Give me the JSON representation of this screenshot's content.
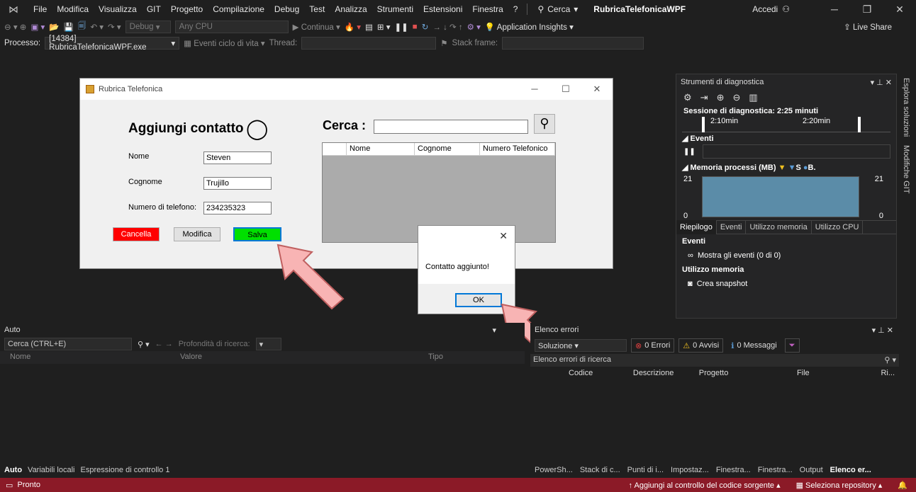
{
  "menubar": {
    "items": [
      "File",
      "Modifica",
      "Visualizza",
      "GIT",
      "Progetto",
      "Compilazione",
      "Debug",
      "Test",
      "Analizza",
      "Strumenti",
      "Estensioni",
      "Finestra",
      "?"
    ],
    "search": "Cerca",
    "app_name": "RubricaTelefonicaWPF",
    "account": "Accedi"
  },
  "toolbar1": {
    "config": "Debug",
    "platform": "Any CPU",
    "continue": "Continua",
    "insights": "Application Insights",
    "live_share": "Live Share"
  },
  "toolbar2": {
    "process_label": "Processo:",
    "process_value": "[14384] RubricaTelefonicaWPF.exe",
    "lifecycle": "Eventi ciclo di vita",
    "thread": "Thread:",
    "stack_frame": "Stack frame:"
  },
  "diag": {
    "title": "Strumenti di diagnostica",
    "session": "Sessione di diagnostica: 2:25 minuti",
    "t1": "2:10min",
    "t2": "2:20min",
    "events": "Eventi",
    "memory": "Memoria processi (MB)",
    "legend_s": "S",
    "legend_b": "B.",
    "mem_top_left": "21",
    "mem_top_right": "21",
    "mem_bot_left": "0",
    "mem_bot_right": "0",
    "tabs": [
      "Riepilogo",
      "Eventi",
      "Utilizzo memoria",
      "Utilizzo CPU"
    ],
    "section_events": "Eventi",
    "show_events": "Mostra gli eventi (0 di 0)",
    "section_memory": "Utilizzo memoria",
    "snapshot": "Crea snapshot"
  },
  "vtabs": [
    "Esplora soluzioni",
    "Modifiche GIT"
  ],
  "wpf": {
    "title": "Rubrica Telefonica",
    "heading": "Aggiungi contatto",
    "search_label": "Cerca :",
    "name_label": "Nome",
    "name_value": "Steven",
    "surname_label": "Cognome",
    "surname_value": "Trujillo",
    "phone_label": "Numero di telefono:",
    "phone_value": "234235323",
    "btn_delete": "Cancella",
    "btn_edit": "Modifica",
    "btn_save": "Salva",
    "grid_cols": [
      "Nome",
      "Cognome",
      "Numero Telefonico"
    ],
    "colors": {
      "delete": "#ff0000",
      "save": "#00e000"
    }
  },
  "msgbox": {
    "text": "Contatto aggiunto!",
    "ok": "OK"
  },
  "auto": {
    "title": "Auto",
    "search": "Cerca (CTRL+E)",
    "depth": "Profondità di ricerca:",
    "cols": [
      "Nome",
      "Valore",
      "Tipo"
    ],
    "tabs": [
      "Auto",
      "Variabili locali",
      "Espressione di controllo 1"
    ]
  },
  "errors": {
    "title": "Elenco errori",
    "scope": "Soluzione",
    "errors": "0 Errori",
    "warnings": "0 Avvisi",
    "messages": "0 Messaggi",
    "search": "Elenco errori di ricerca",
    "cols": [
      "Codice",
      "Descrizione",
      "Progetto",
      "File",
      "Ri..."
    ],
    "tabs": [
      "PowerSh...",
      "Stack di c...",
      "Punti di i...",
      "Impostaz...",
      "Finestra...",
      "Finestra...",
      "Output",
      "Elenco er..."
    ]
  },
  "status": {
    "ready": "Pronto",
    "scm": "Aggiungi al controllo del codice sorgente",
    "repo": "Seleziona repository"
  }
}
